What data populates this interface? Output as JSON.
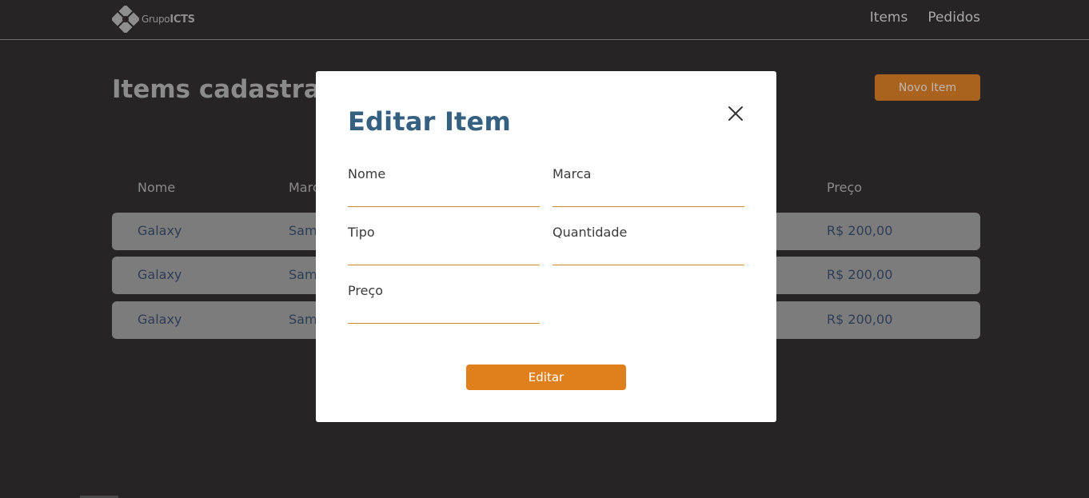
{
  "logo": {
    "prefix": "Grupo",
    "brand": "ICTS"
  },
  "nav": {
    "items": [
      {
        "label": "Items"
      },
      {
        "label": "Pedidos"
      }
    ]
  },
  "page": {
    "title": "Items cadastrados",
    "new_item_label": "Novo Item"
  },
  "table": {
    "columns": [
      "Nome",
      "Marca",
      "Preço"
    ],
    "rows": [
      {
        "nome": "Galaxy",
        "marca": "Samsung",
        "preco": "R$ 200,00"
      },
      {
        "nome": "Galaxy",
        "marca": "Samsung",
        "preco": "R$ 200,00"
      },
      {
        "nome": "Galaxy",
        "marca": "Samsung",
        "preco": "R$ 200,00"
      }
    ]
  },
  "modal": {
    "title": "Editar Item",
    "close_icon": "close-icon",
    "fields": {
      "nome": {
        "label": "Nome",
        "value": ""
      },
      "marca": {
        "label": "Marca",
        "value": ""
      },
      "tipo": {
        "label": "Tipo",
        "value": ""
      },
      "quantidade": {
        "label": "Quantidade",
        "value": ""
      },
      "preco": {
        "label": "Preço",
        "value": ""
      }
    },
    "submit_label": "Editar"
  },
  "colors": {
    "accent_orange": "#df801d",
    "modal_title": "#35607f",
    "field_underline": "#cf8e2d",
    "background": "#262425"
  }
}
